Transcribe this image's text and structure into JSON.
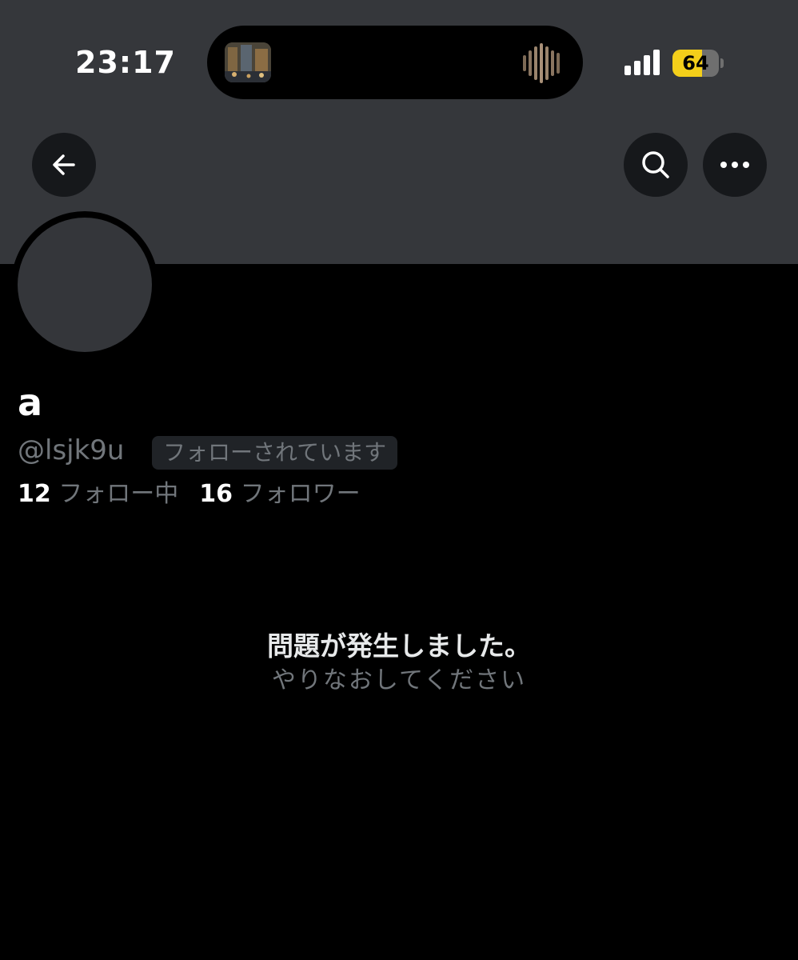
{
  "status_bar": {
    "time": "23:17",
    "battery_level": "64",
    "battery_fraction": 0.64,
    "signal_icon": "cellular-signal-icon",
    "battery_color": "#f4cf1a"
  },
  "dynamic_island": {
    "artwork_icon": "album-artwork-icon",
    "waveform_icon": "audio-waveform-icon"
  },
  "nav": {
    "back_icon": "arrow-left-icon",
    "search_icon": "search-icon",
    "more_icon": "more-horizontal-icon"
  },
  "profile": {
    "display_name": "a",
    "handle": "@lsjk9u",
    "follows_you_badge": "フォローされています",
    "following_count": "12",
    "following_label": "フォロー中",
    "followers_count": "16",
    "followers_label": "フォロワー"
  },
  "error": {
    "title": "問題が発生しました。",
    "subtitle": "やりなおしてください"
  },
  "colors": {
    "banner": "#35373b",
    "background": "#000000",
    "secondary_text": "#71767b",
    "primary_text": "#e7e9ea"
  }
}
